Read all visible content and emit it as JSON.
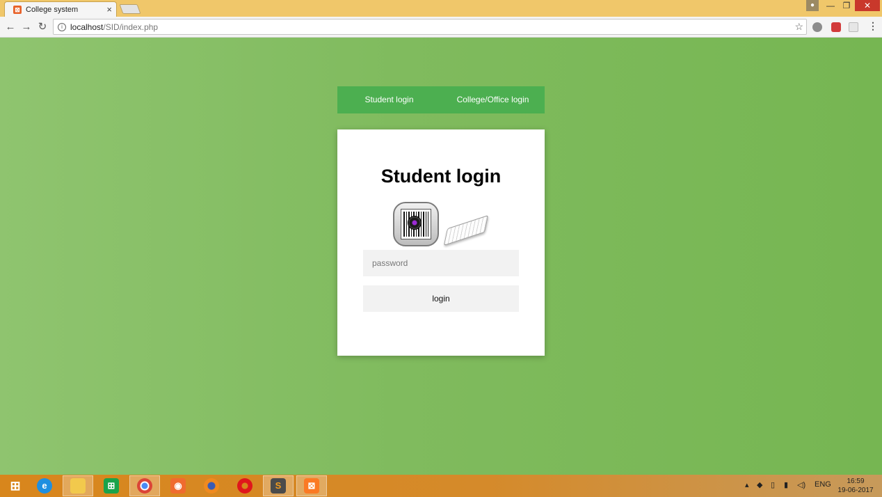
{
  "browser": {
    "tab_title": "College system",
    "tab_close": "×",
    "url_host": "localhost",
    "url_path": "/SID/index.php",
    "window_controls": {
      "minimize": "—",
      "maximize": "❐",
      "close": "✕"
    }
  },
  "nav": {
    "student_login": "Student login",
    "college_login": "College/Office login"
  },
  "card": {
    "title": "Student login",
    "password_placeholder": "password",
    "login_button": "login"
  },
  "taskbar": {
    "apps": [
      "windows-start",
      "internet-explorer",
      "file-explorer",
      "store",
      "chrome",
      "app-orange",
      "firefox",
      "opera",
      "sublime-text",
      "xampp"
    ],
    "language": "ENG",
    "time": "16:59",
    "date": "19-06-2017"
  },
  "colors": {
    "page_background": "#7fbb5c",
    "nav_bar": "#4caf50",
    "titlebar": "#f0c76a",
    "taskbar": "#d8861c"
  }
}
